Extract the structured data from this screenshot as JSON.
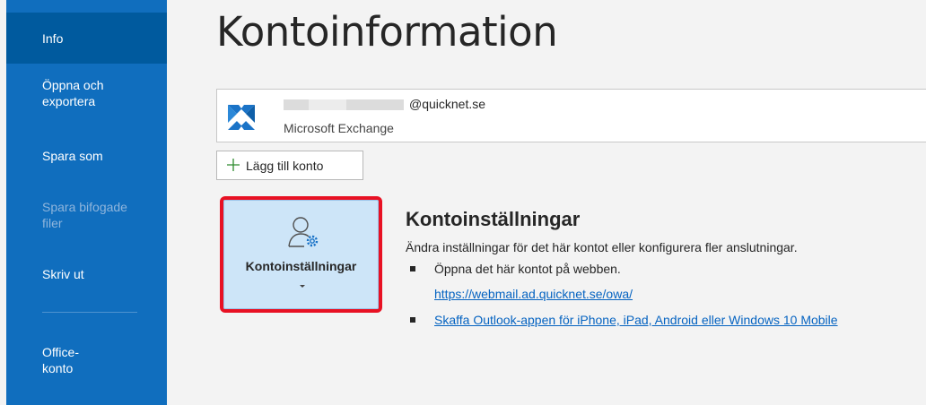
{
  "sidebar": {
    "items": [
      {
        "label": "Info",
        "state": "active"
      },
      {
        "label": "Öppna och\nexportera",
        "state": "normal"
      },
      {
        "label": "Spara som",
        "state": "normal"
      },
      {
        "label": "Spara bifogade\nfiler",
        "state": "disabled"
      },
      {
        "label": "Skriv ut",
        "state": "normal"
      },
      {
        "label": "Office-\nkonto",
        "state": "normal"
      }
    ]
  },
  "page": {
    "title": "Kontoinformation"
  },
  "account": {
    "email_suffix": "@quicknet.se",
    "type": "Microsoft Exchange",
    "icon": "exchange-icon"
  },
  "add_account": {
    "label": "Lägg till konto",
    "icon": "plus-icon"
  },
  "settings_tile": {
    "label": "Kontoinställningar",
    "icon": "person-gear-icon"
  },
  "section": {
    "title": "Kontoinställningar",
    "description": "Ändra inställningar för det här kontot eller konfigurera fler anslutningar.",
    "bullet1_text": "Öppna det här kontot på webben.",
    "bullet1_link": "https://webmail.ad.quicknet.se/owa/",
    "bullet2_link": "Skaffa Outlook-appen för iPhone, iPad, Android eller Windows 10 Mobile"
  },
  "colors": {
    "sidebar": "#106ebe",
    "sidebar_active": "#005a9e",
    "highlight_border": "#e81123",
    "tile_background": "#cde5f8",
    "link": "#0563c1"
  }
}
